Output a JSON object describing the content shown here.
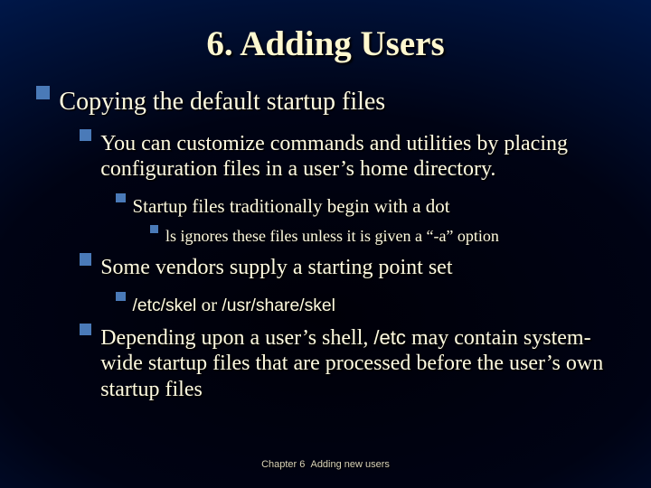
{
  "title": "6. Adding Users",
  "l1": "Copying the default startup files",
  "l2a": "You can customize commands and utilities by placing configuration files in a user’s home directory.",
  "l3a": "Startup files traditionally begin with a dot",
  "l4a": "ls ignores these files unless it is given a “-a” option",
  "l2b": "Some vendors supply a starting point set",
  "l3b_pre": "/etc/skel",
  "l3b_mid": " or ",
  "l3b_post": "/usr/share/skel",
  "l2c_pre": "Depending upon a user’s shell, ",
  "l2c_code": "/etc",
  "l2c_post": " may contain system-wide startup files that are processed before the user’s own startup files",
  "footer": "Chapter 6  Adding new users"
}
